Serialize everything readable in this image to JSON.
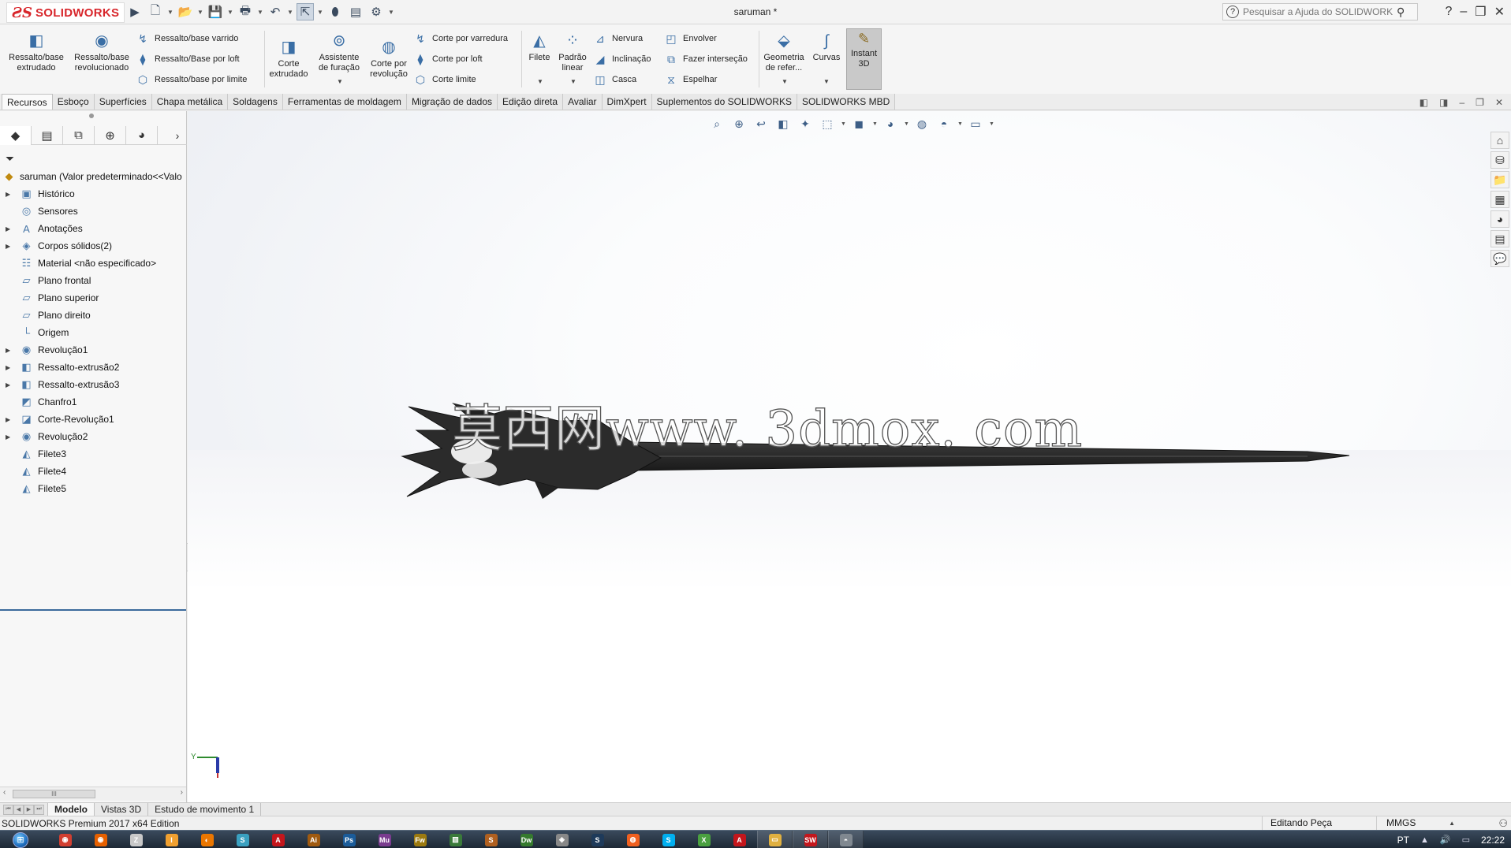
{
  "app": {
    "brand_ds": "ƧS",
    "brand_name": "SOLIDWORKS",
    "document_title": "saruman *",
    "help_search_placeholder": "Pesquisar a Ajuda do SOLIDWORKS",
    "help_label": "?"
  },
  "ribbon": {
    "extruded_boss": "Ressalto/base extrudado",
    "revolved_boss": "Ressalto/base revolucionado",
    "swept_boss": "Ressalto/base varrido",
    "lofted_boss": "Ressalto/Base por loft",
    "boundary_boss": "Ressalto/base por limite",
    "extruded_cut": "Corte extrudado",
    "hole_wizard": "Assistente de furação",
    "revolved_cut": "Corte por revolução",
    "swept_cut": "Corte por varredura",
    "lofted_cut": "Corte por loft",
    "boundary_cut": "Corte limite",
    "fillet": "Filete",
    "linear_pattern": "Padrão linear",
    "rib": "Nervura",
    "draft": "Inclinação",
    "shell": "Casca",
    "wrap": "Envolver",
    "intersect": "Fazer interseção",
    "mirror": "Espelhar",
    "ref_geometry": "Geometria de refer...",
    "curves": "Curvas",
    "instant3d": "Instant 3D"
  },
  "tabs": [
    "Recursos",
    "Esboço",
    "Superfícies",
    "Chapa metálica",
    "Soldagens",
    "Ferramentas de moldagem",
    "Migração de dados",
    "Edição direta",
    "Avaliar",
    "DimXpert",
    "Suplementos do SOLIDWORKS",
    "SOLIDWORKS MBD"
  ],
  "tree": {
    "root": "saruman  (Valor predeterminado<<Valo",
    "items": [
      {
        "label": "Histórico",
        "icon": "history-folder-icon",
        "expandable": true,
        "glyph": "▣"
      },
      {
        "label": "Sensores",
        "icon": "sensors-folder-icon",
        "expandable": false,
        "glyph": "◎"
      },
      {
        "label": "Anotações",
        "icon": "annotations-folder-icon",
        "expandable": true,
        "glyph": "A"
      },
      {
        "label": "Corpos sólidos(2)",
        "icon": "solid-bodies-folder-icon",
        "expandable": true,
        "glyph": "◈"
      },
      {
        "label": "Material <não especificado>",
        "icon": "material-icon",
        "expandable": false,
        "glyph": "☷"
      },
      {
        "label": "Plano frontal",
        "icon": "plane-icon",
        "expandable": false,
        "glyph": "▱"
      },
      {
        "label": "Plano superior",
        "icon": "plane-icon",
        "expandable": false,
        "glyph": "▱"
      },
      {
        "label": "Plano direito",
        "icon": "plane-icon",
        "expandable": false,
        "glyph": "▱"
      },
      {
        "label": "Origem",
        "icon": "origin-icon",
        "expandable": false,
        "glyph": "└"
      },
      {
        "label": "Revolução1",
        "icon": "revolve-feature-icon",
        "expandable": true,
        "glyph": "◉"
      },
      {
        "label": "Ressalto-extrusão2",
        "icon": "extrude-feature-icon",
        "expandable": true,
        "glyph": "◧"
      },
      {
        "label": "Ressalto-extrusão3",
        "icon": "extrude-feature-icon",
        "expandable": true,
        "glyph": "◧"
      },
      {
        "label": "Chanfro1",
        "icon": "chamfer-feature-icon",
        "expandable": false,
        "glyph": "◩"
      },
      {
        "label": "Corte-Revolução1",
        "icon": "revolve-cut-feature-icon",
        "expandable": true,
        "glyph": "◪"
      },
      {
        "label": "Revolução2",
        "icon": "revolve-feature-icon",
        "expandable": true,
        "glyph": "◉"
      },
      {
        "label": "Filete3",
        "icon": "fillet-feature-icon",
        "expandable": false,
        "glyph": "◭"
      },
      {
        "label": "Filete4",
        "icon": "fillet-feature-icon",
        "expandable": false,
        "glyph": "◭"
      },
      {
        "label": "Filete5",
        "icon": "fillet-feature-icon",
        "expandable": false,
        "glyph": "◭"
      }
    ]
  },
  "viewport": {
    "watermark": "莫西网www. 3dmox. com",
    "triad_y": "Y"
  },
  "bottom_tabs": [
    "Modelo",
    "Vistas 3D",
    "Estudo de movimento 1"
  ],
  "status": {
    "product": "SOLIDWORKS Premium 2017 x64 Edition",
    "mode": "Editando Peça",
    "units": "MMGS"
  },
  "taskbar": {
    "language": "PT",
    "time": "22:22",
    "apps": [
      {
        "name": "chrome-icon",
        "color": "#d23f31",
        "letter": "◉"
      },
      {
        "name": "firefox-icon",
        "color": "#e66000",
        "letter": "◉"
      },
      {
        "name": "app-icon",
        "color": "#c8c8c8",
        "letter": "Z"
      },
      {
        "name": "illustrator-alt-icon",
        "color": "#f0a030",
        "letter": "I"
      },
      {
        "name": "blender-icon",
        "color": "#ea7600",
        "letter": "◐"
      },
      {
        "name": "app2-icon",
        "color": "#3aa0c0",
        "letter": "S"
      },
      {
        "name": "acrobat-icon",
        "color": "#c4161c",
        "letter": "A"
      },
      {
        "name": "illustrator-icon",
        "color": "#a05a10",
        "letter": "Ai"
      },
      {
        "name": "photoshop-icon",
        "color": "#1b5c9a",
        "letter": "Ps"
      },
      {
        "name": "muse-icon",
        "color": "#7a3c8f",
        "letter": "Mu"
      },
      {
        "name": "fireworks-icon",
        "color": "#9c7a10",
        "letter": "Fw"
      },
      {
        "name": "chart-app-icon",
        "color": "#3a7a3a",
        "letter": "▥"
      },
      {
        "name": "sketchup-icon",
        "color": "#b06020",
        "letter": "S"
      },
      {
        "name": "dreamweaver-icon",
        "color": "#357a2e",
        "letter": "Dw"
      },
      {
        "name": "app3-icon",
        "color": "#888888",
        "letter": "◈"
      },
      {
        "name": "steam-icon",
        "color": "#1e3a5a",
        "letter": "S"
      },
      {
        "name": "origin-app-icon",
        "color": "#f06020",
        "letter": "◍"
      },
      {
        "name": "skype-icon",
        "color": "#00aff0",
        "letter": "S"
      },
      {
        "name": "xbox-icon",
        "color": "#4aa040",
        "letter": "X"
      },
      {
        "name": "autodesk-icon",
        "color": "#c4161c",
        "letter": "A"
      },
      {
        "name": "explorer-icon",
        "color": "#e0b040",
        "letter": "▭"
      },
      {
        "name": "solidworks-taskbar-icon",
        "color": "#c4161c",
        "letter": "SW"
      },
      {
        "name": "app4-icon",
        "color": "#808890",
        "letter": "◓"
      }
    ]
  }
}
